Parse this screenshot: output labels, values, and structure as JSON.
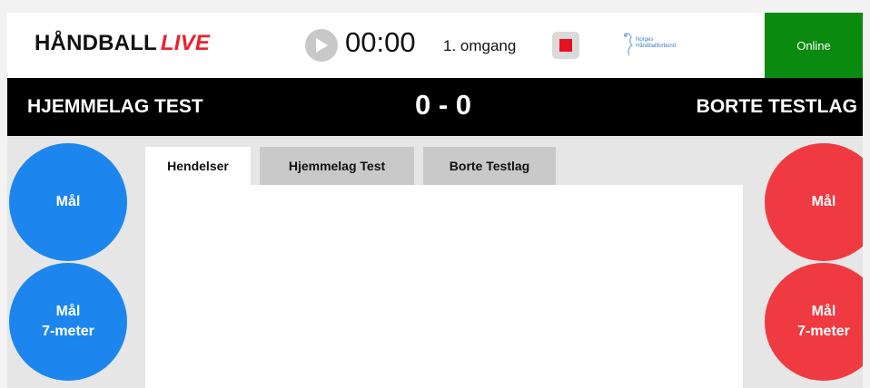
{
  "header": {
    "brand_main": "HÅNDBALL",
    "brand_live": "LIVE",
    "clock": "00:00",
    "period": "1. omgang",
    "federation_logo_line1": "Norges",
    "federation_logo_line2": "Håndballforbund",
    "status": "Online"
  },
  "scoreboard": {
    "home_team": "HJEMMELAG TEST",
    "score": "0 - 0",
    "away_team": "BORTE TESTLAG"
  },
  "home_actions": {
    "goal_label": "Mål",
    "penalty_line1": "Mål",
    "penalty_line2": "7-meter"
  },
  "away_actions": {
    "goal_label": "Mål",
    "penalty_line1": "Mål",
    "penalty_line2": "7-meter"
  },
  "tabs": [
    {
      "label": "Hendelser",
      "active": true
    },
    {
      "label": "Hjemmelag Test",
      "active": false
    },
    {
      "label": "Borte Testlag",
      "active": false
    }
  ],
  "colors": {
    "home_accent": "#1c86ee",
    "away_accent": "#f03a42",
    "online": "#0b8a10",
    "live_red": "#e8222f",
    "stop_red": "#e8111f"
  },
  "icons": {
    "play": "play-icon",
    "stop": "stop-icon",
    "logo": "federation-logo"
  }
}
